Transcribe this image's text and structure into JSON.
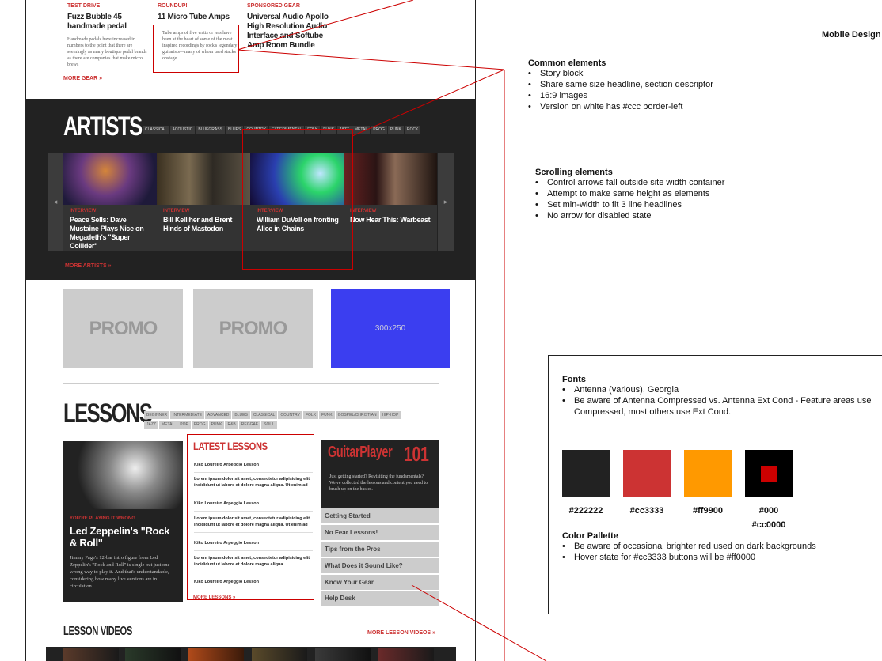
{
  "top_stories": [
    {
      "kicker": "TEST DRIVE",
      "headline": "Fuzz Bubble 45 handmade pedal",
      "dek": "Handmade pedals have increased in numbers to the point that there are seemingly as many boutique pedal brands as there are companies that make micro brews"
    },
    {
      "kicker": "ROUNDUP!",
      "headline": "11 Micro Tube Amps",
      "dek": "Tube amps of five watts or less have been at the heart of some of the most inspired recordings by rock's legendary guitarists—many of whom used stacks onstage."
    },
    {
      "kicker": "SPONSORED GEAR",
      "headline": "Universal Audio Apollo High Resolution Audio Interface and Softube Amp Room Bundle",
      "dek": ""
    }
  ],
  "more_gear": "MORE GEAR »",
  "artists": {
    "title": "ARTISTS",
    "tags": [
      "CLASSICAL",
      "ACOUSTIC",
      "BLUEGRASS",
      "BLUES",
      "COUNTRY",
      "EXPERIMENTAL",
      "FOLK",
      "FUNK",
      "JAZZ",
      "METAL",
      "PROG",
      "PUNK",
      "ROCK"
    ],
    "cards": [
      {
        "kicker": "INTERVIEW",
        "headline": "Peace Sells: Dave Mustaine Plays Nice on Megadeth's \"Super Collider\""
      },
      {
        "kicker": "INTERVIEW",
        "headline": "Bill Kelliher and Brent Hinds of Mastodon"
      },
      {
        "kicker": "INTERVIEW",
        "headline": "William DuVall on fronting Alice in Chains"
      },
      {
        "kicker": "INTERVIEW",
        "headline": "Now Hear This: Warbeast"
      }
    ],
    "left_arrow": "◂",
    "right_arrow": "▸",
    "more": "MORE ARTISTS »"
  },
  "promos": [
    "PROMO",
    "PROMO",
    "300x250"
  ],
  "lessons": {
    "title": "LESSONS",
    "tags_row1": [
      "BEGINNER",
      "INTERMEDIATE",
      "ADVANCED",
      "BLUES",
      "CLASSICAL",
      "COUNTRY",
      "FOLK",
      "FUNK",
      "GOSPEL/CHRISTIAN",
      "HIP-HOP"
    ],
    "tags_row2": [
      "JAZZ",
      "METAL",
      "POP",
      "PROG",
      "PUNK",
      "R&B",
      "REGGAE",
      "SOUL"
    ],
    "feature": {
      "kicker": "YOU'RE PLAYING IT WRONG",
      "headline": "Led Zeppelin's \"Rock & Roll\"",
      "dek": "Jimmy Page's 12-bar intro figure from Led Zeppelin's \"Rock and Roll\" is single out just one wrong way to play it. And that's understandable, considering how many live versions are in circulation..."
    },
    "latest_title": "LATEST LESSONS",
    "latest_items": [
      "Kiko Loureiro Arpeggio Lesson",
      "Lorem ipsum dolor sit amet, consectetur adipisicing elit incididunt ut labore et dolore magna aliqua. Ut enim ad",
      "Kiko Loureiro Arpeggio Lesson",
      "Lorem ipsum dolor sit amet, consectetur adipisicing elit incididunt ut labore et dolore magna aliqua. Ut enim ad",
      "Kiko Loureiro Arpeggio Lesson",
      "Lorem ipsum dolor sit amet, consectetur adipisicing elit incididunt ut labore et dolore magna aliqua",
      "Kiko Loureiro Arpeggio Lesson"
    ],
    "more_lessons": "MORE LESSONS »",
    "gp101": {
      "logo_left": "GuitarPlayer",
      "logo_right": "101",
      "intro": "Just getting started? Revisiting the fundamentals? We've collected the lessons and content you need to brush up on the basics.",
      "links": [
        "Getting Started",
        "No Fear Lessons!",
        "Tips from the Pros",
        "What Does it Sound Like?",
        "Know Your Gear",
        "Help Desk"
      ]
    }
  },
  "lesson_videos": {
    "title": "LESSON VIDEOS",
    "more": "MORE LESSON VIDEOS »"
  },
  "annotations": {
    "mobile_design": "Mobile Design",
    "common": {
      "title": "Common elements",
      "items": [
        "Story block",
        "Share same size headline, section descriptor",
        "16:9 images",
        "Version on white has #ccc border-left"
      ]
    },
    "scrolling": {
      "title": "Scrolling elements",
      "items": [
        "Control arrows fall outside site width container",
        "Attempt to make same height as elements",
        "Set min-width to fit 3 line headlines",
        "No arrow for disabled state"
      ]
    },
    "fonts": {
      "title": "Fonts",
      "items": [
        "Antenna (various), Georgia",
        "Be aware of Antenna Compressed vs. Antenna Ext Cond - Feature areas use Compressed, most others use Ext Cond."
      ]
    },
    "palette": {
      "swatches": [
        {
          "label": "#222222",
          "color": "#222222"
        },
        {
          "label": "#cc3333",
          "color": "#cc3333"
        },
        {
          "label": "#ff9900",
          "color": "#ff9900"
        },
        {
          "label": "#000",
          "label2": "#cc0000",
          "color": "#000000",
          "inner": "#cc0000"
        }
      ],
      "title": "Color Pallette",
      "items": [
        "Be aware of occasional brighter red used on dark backgrounds",
        "Hover state for #cc3333 buttons will be #ff0000"
      ]
    },
    "bullet": "•"
  }
}
